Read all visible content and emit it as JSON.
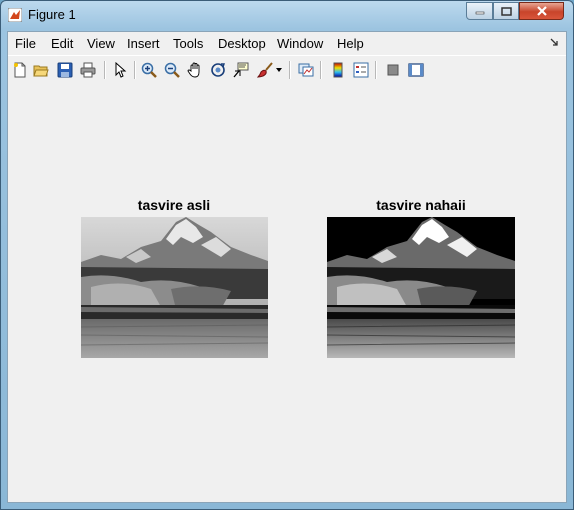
{
  "window": {
    "title": "Figure 1"
  },
  "menu": [
    "File",
    "Edit",
    "View",
    "Insert",
    "Tools",
    "Desktop",
    "Window",
    "Help"
  ],
  "toolbar": [
    "new-figure-icon",
    "open-file-icon",
    "save-figure-icon",
    "print-figure-icon",
    "edit-plot-icon",
    "zoom-in-icon",
    "zoom-out-icon",
    "pan-icon",
    "rotate-3d-icon",
    "data-cursor-icon",
    "brush-icon",
    "link-plot-icon",
    "colorbar-icon",
    "legend-icon",
    "hide-plot-tools-icon",
    "show-plot-tools-icon"
  ],
  "axes": [
    {
      "title": "tasvire asli"
    },
    {
      "title": "tasvire nahaii"
    }
  ]
}
